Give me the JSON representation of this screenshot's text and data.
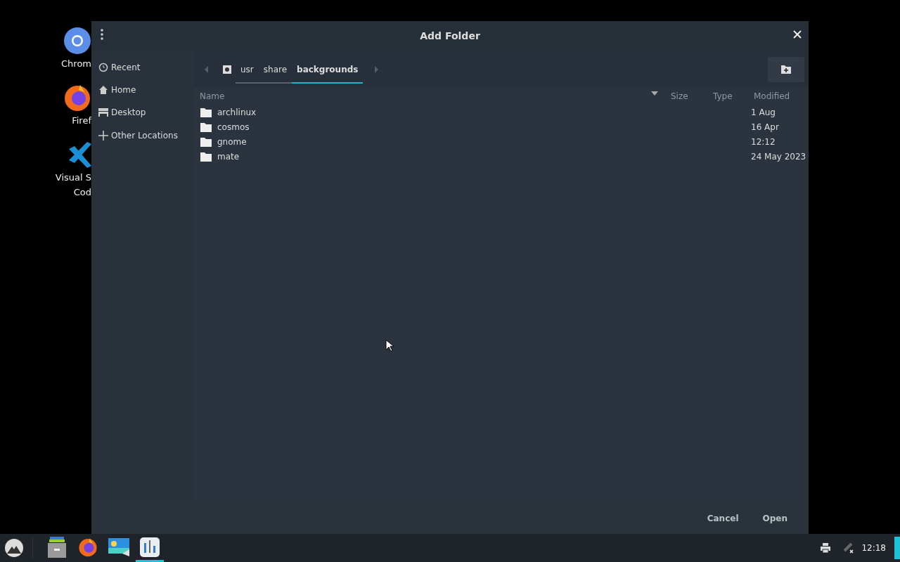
{
  "desktop_icons": [
    {
      "lines": [
        "Chrom"
      ]
    },
    {
      "lines": [
        "Firef"
      ]
    },
    {
      "lines": [
        "Visual S",
        "Cod"
      ]
    }
  ],
  "dialog": {
    "title": "Add Folder",
    "sidebar": [
      {
        "kind": "recent",
        "label": "Recent"
      },
      {
        "kind": "home",
        "label": "Home"
      },
      {
        "kind": "desktop",
        "label": "Desktop"
      },
      {
        "kind": "other",
        "label": "Other Locations"
      }
    ],
    "path": [
      {
        "label": "usr",
        "selected": false
      },
      {
        "label": "share",
        "selected": false
      },
      {
        "label": "backgrounds",
        "selected": true
      }
    ],
    "columns": [
      "Name",
      "Size",
      "Type",
      "Modified"
    ],
    "rows": [
      {
        "name": "archlinux",
        "modified": "1 Aug"
      },
      {
        "name": "cosmos",
        "modified": "16 Apr"
      },
      {
        "name": "gnome",
        "modified": "12:12"
      },
      {
        "name": "mate",
        "modified": "24 May 2023"
      }
    ],
    "buttons": [
      "Cancel",
      "Open"
    ]
  },
  "taskbar": {
    "apps": [
      {
        "kind": "files",
        "selected": false
      },
      {
        "kind": "firefox",
        "selected": false
      },
      {
        "kind": "image",
        "selected": false
      },
      {
        "kind": "mixer",
        "selected": true
      }
    ],
    "clock": "12:18"
  }
}
